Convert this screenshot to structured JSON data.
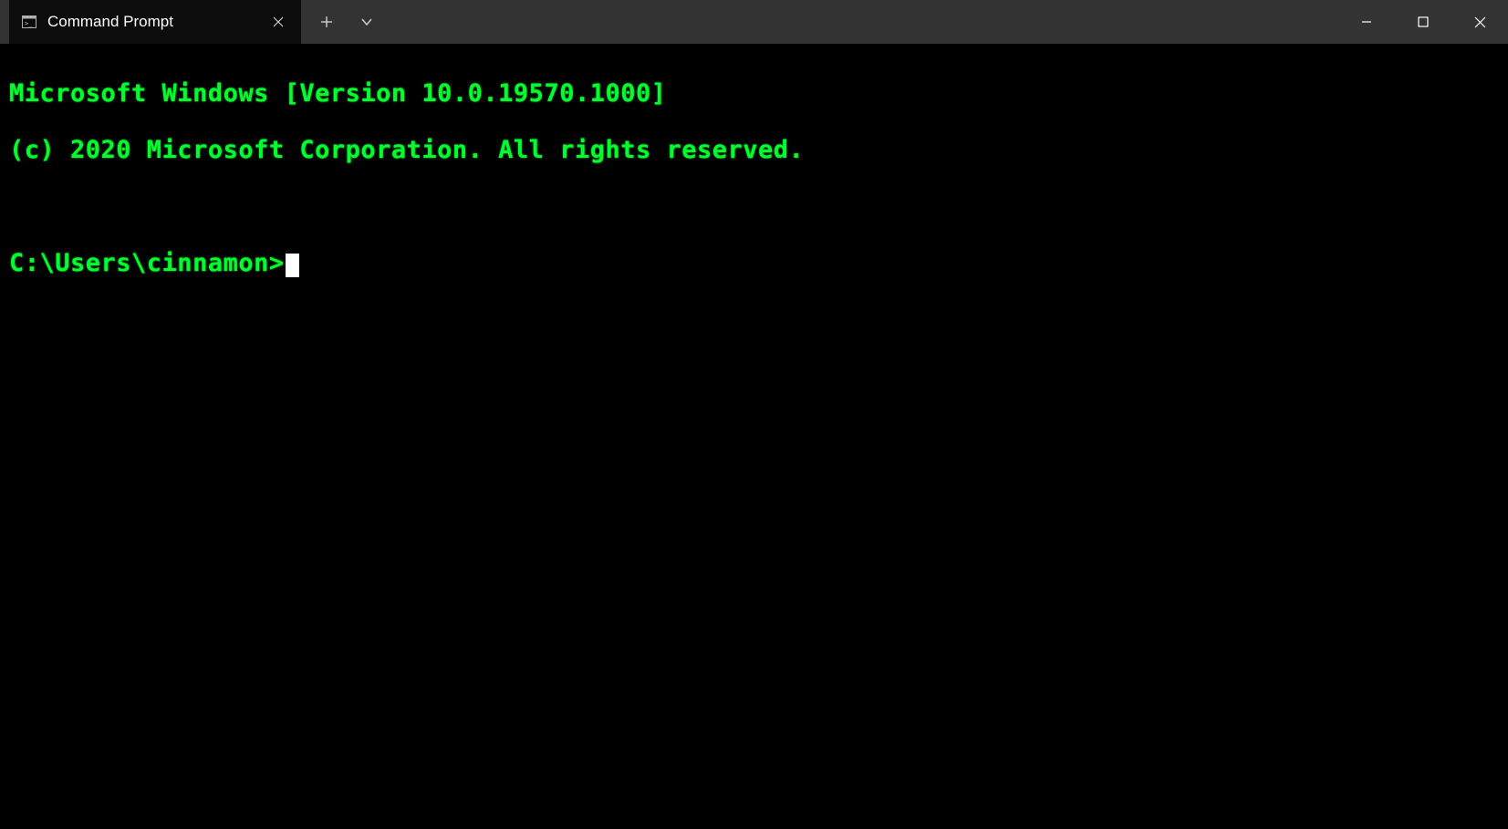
{
  "titlebar": {
    "tab": {
      "title": "Command Prompt",
      "icon_name": "terminal-icon"
    },
    "new_tab_label": "+",
    "dropdown_label": "v"
  },
  "window_controls": {
    "minimize": "minimize",
    "maximize": "maximize",
    "close": "close"
  },
  "terminal": {
    "line1": "Microsoft Windows [Version 10.0.19570.1000]",
    "line2": "(c) 2020 Microsoft Corporation. All rights reserved.",
    "prompt": "C:\\Users\\cinnamon>"
  }
}
